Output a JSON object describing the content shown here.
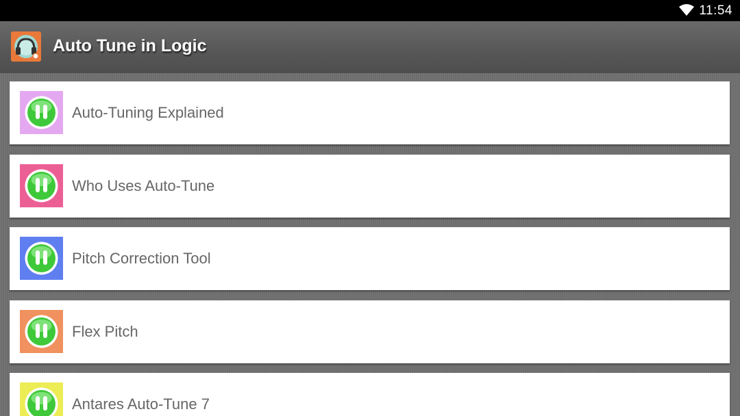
{
  "status_bar": {
    "time": "11:54",
    "wifi_icon": "wifi-icon"
  },
  "app_bar": {
    "title": "Auto Tune in Logic",
    "logo_icon": "headphones-logo-icon",
    "logo_color": "#e9793a"
  },
  "list": {
    "items": [
      {
        "label": "Auto-Tuning Explained",
        "thumb_color": "#e4a8f0",
        "icon": "pause-icon"
      },
      {
        "label": "Who Uses Auto-Tune",
        "thumb_color": "#ec5f95",
        "icon": "pause-icon"
      },
      {
        "label": "Pitch Correction Tool",
        "thumb_color": "#5f7ff0",
        "icon": "pause-icon"
      },
      {
        "label": "Flex Pitch",
        "thumb_color": "#f0915f",
        "icon": "pause-icon"
      },
      {
        "label": "Antares Auto-Tune 7",
        "thumb_color": "#ecec55",
        "icon": "pause-icon"
      }
    ]
  },
  "colors": {
    "button_green": "#3fc93a",
    "button_ring": "#ffffff",
    "text": "#666666"
  }
}
